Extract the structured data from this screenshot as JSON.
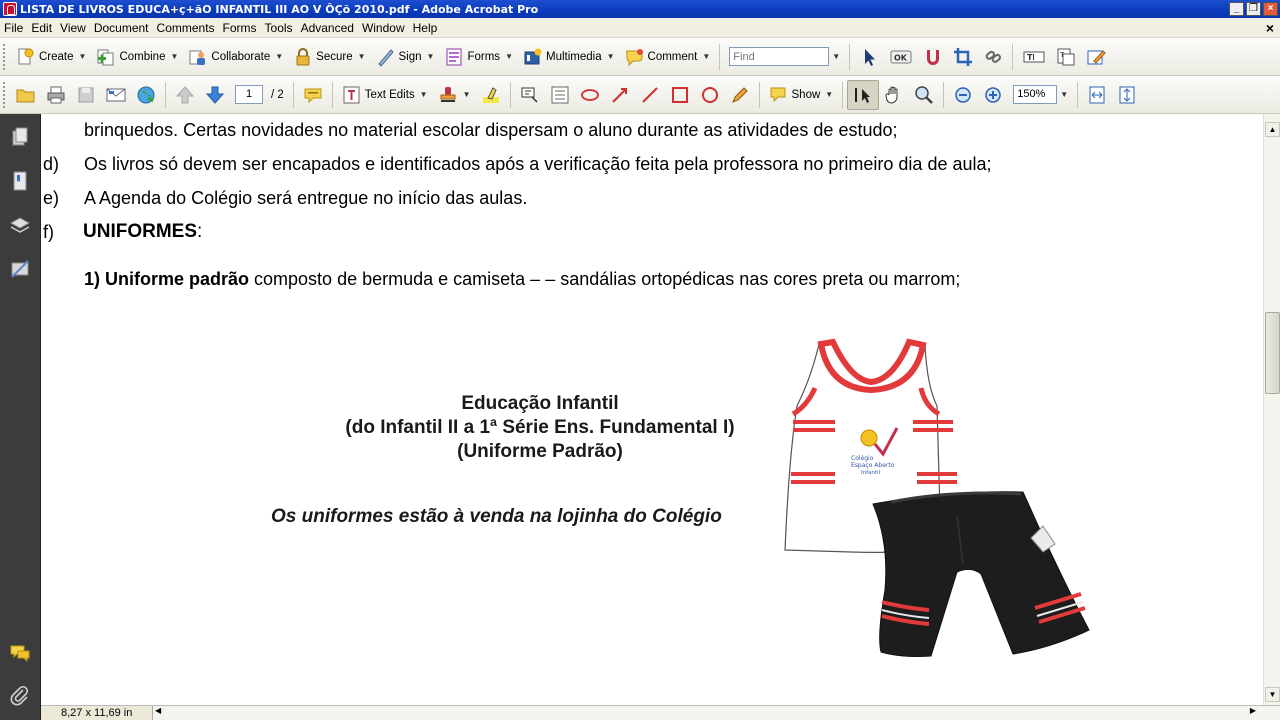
{
  "window": {
    "title": "LISTA DE LIVROS EDUCA+ç+ãO INFANTIL III AO V ÔÇõ 2010.pdf - Adobe Acrobat Pro",
    "minimize": "_",
    "restore": "❐",
    "close": "×"
  },
  "menu": {
    "items": [
      "File",
      "Edit",
      "View",
      "Document",
      "Comments",
      "Forms",
      "Tools",
      "Advanced",
      "Window",
      "Help"
    ],
    "close": "×"
  },
  "toolbar1": {
    "create": "Create",
    "combine": "Combine",
    "collaborate": "Collaborate",
    "secure": "Secure",
    "sign": "Sign",
    "forms": "Forms",
    "multimedia": "Multimedia",
    "comment": "Comment",
    "find_placeholder": "Find"
  },
  "toolbar2": {
    "current_page": "1",
    "total_pages": "/ 2",
    "text_edits": "Text Edits",
    "show": "Show",
    "zoom": "150%"
  },
  "document": {
    "line_top": "brinquedos. Certas novidades no material escolar dispersam o aluno durante as atividades de estudo;",
    "item_d_marker": "d)",
    "item_d": "Os livros só devem ser encapados e identificados após a verificação feita pela professora no primeiro dia de aula;",
    "item_e_marker": "e)",
    "item_e": "A Agenda do Colégio será entregue no início das aulas.",
    "item_f_marker": "f)",
    "item_f_bold": "UNIFORMES",
    "item_f_tail": ":",
    "uniform_bold": "1) Uniforme padrão",
    "uniform_text": " composto de bermuda e camiseta – – sandálias ortopédicas nas cores preta ou marrom;",
    "caption_line1": "Educação Infantil",
    "caption_line2": "(do Infantil II a 1ª Série Ens. Fundamental I)",
    "caption_line3": "(Uniforme Padrão)",
    "sale_note": "Os uniformes estão à venda na lojinha do Colégio",
    "shirt_logo_line1": "Colégio",
    "shirt_logo_line2": "Espaço Aberto",
    "shirt_logo_line3": "Infantil"
  },
  "status": {
    "page_size": "8,27 x 11,69 in"
  },
  "colors": {
    "titlebar": "#0a3bbd",
    "uniform_stripe": "#e23a3a",
    "shorts": "#1d1d1d"
  }
}
